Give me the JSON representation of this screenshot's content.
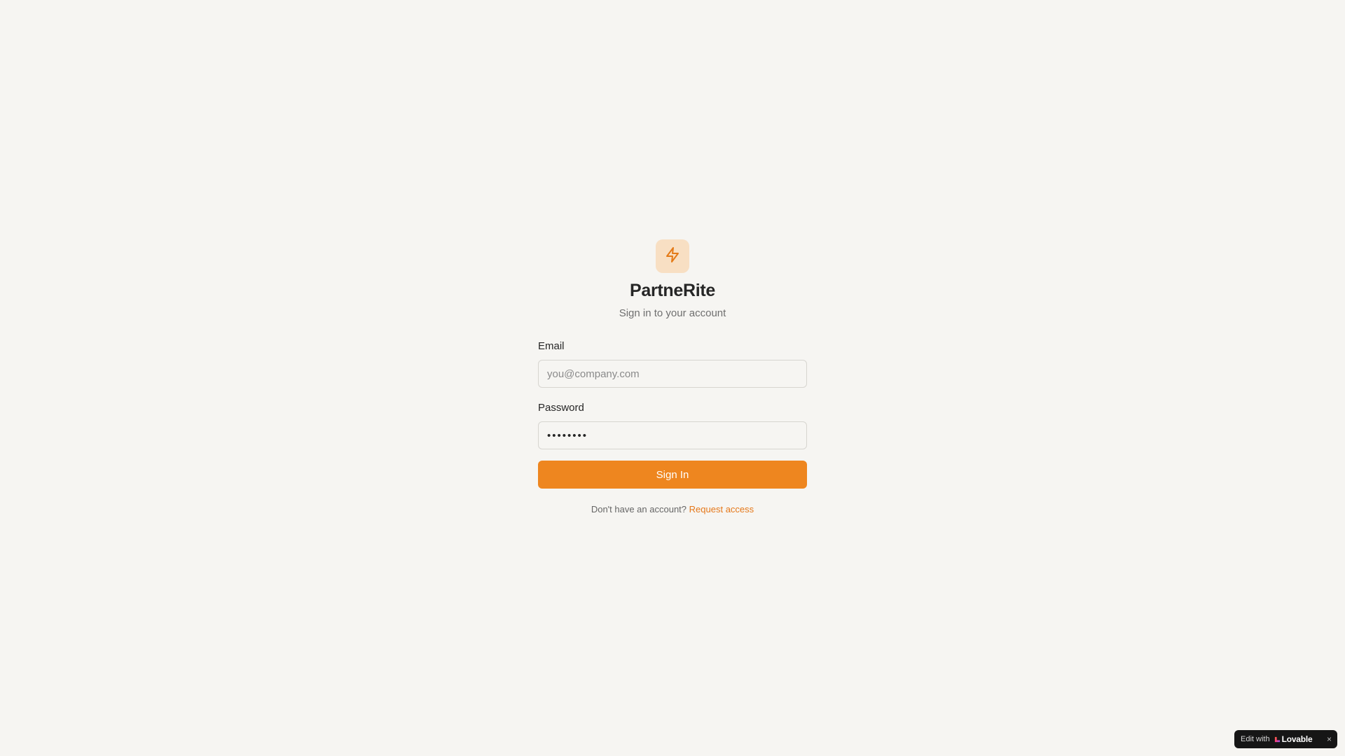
{
  "brand": {
    "name": "PartneRite",
    "subtitle": "Sign in to your account",
    "icon": "lightning-bolt-icon",
    "accent_color": "#ee861f"
  },
  "form": {
    "email": {
      "label": "Email",
      "placeholder": "you@company.com",
      "value": ""
    },
    "password": {
      "label": "Password",
      "value": "••••••••"
    },
    "submit_label": "Sign In"
  },
  "footer": {
    "prompt": "Don't have an account?",
    "link_label": "Request access"
  },
  "badge": {
    "prefix": "Edit with",
    "brand": "Lovable",
    "close": "×"
  }
}
